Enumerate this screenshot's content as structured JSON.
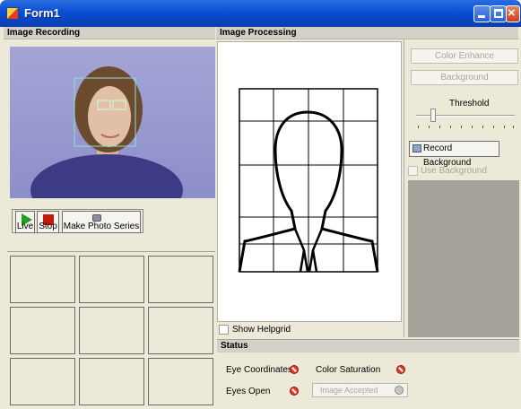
{
  "window": {
    "title": "Form1"
  },
  "image_recording": {
    "header": "Image Recording",
    "toolbar": {
      "live_label": "Live",
      "stop_label": "Stop",
      "photo_series_label": "Make Photo Series"
    }
  },
  "image_processing": {
    "header": "Image Processing",
    "show_helpgrid_label": "Show Helpgrid"
  },
  "controls": {
    "color_enhance_label": "Color Enhance",
    "background_label": "Background",
    "threshold_label": "Threshold",
    "threshold_value": 0.15,
    "record_background_label": "Record Background",
    "use_background_label": "Use Background"
  },
  "status": {
    "header": "Status",
    "eye_coordinates_label": "Eye Coordinates",
    "color_saturation_label": "Color Saturation",
    "eyes_open_label": "Eyes Open",
    "image_accepted_label": "Image Accepted"
  },
  "colors": {
    "titlebar": "#0a52d6",
    "status_error": "#e23a2a",
    "play": "#1fa01f",
    "stop": "#c31a0a"
  }
}
